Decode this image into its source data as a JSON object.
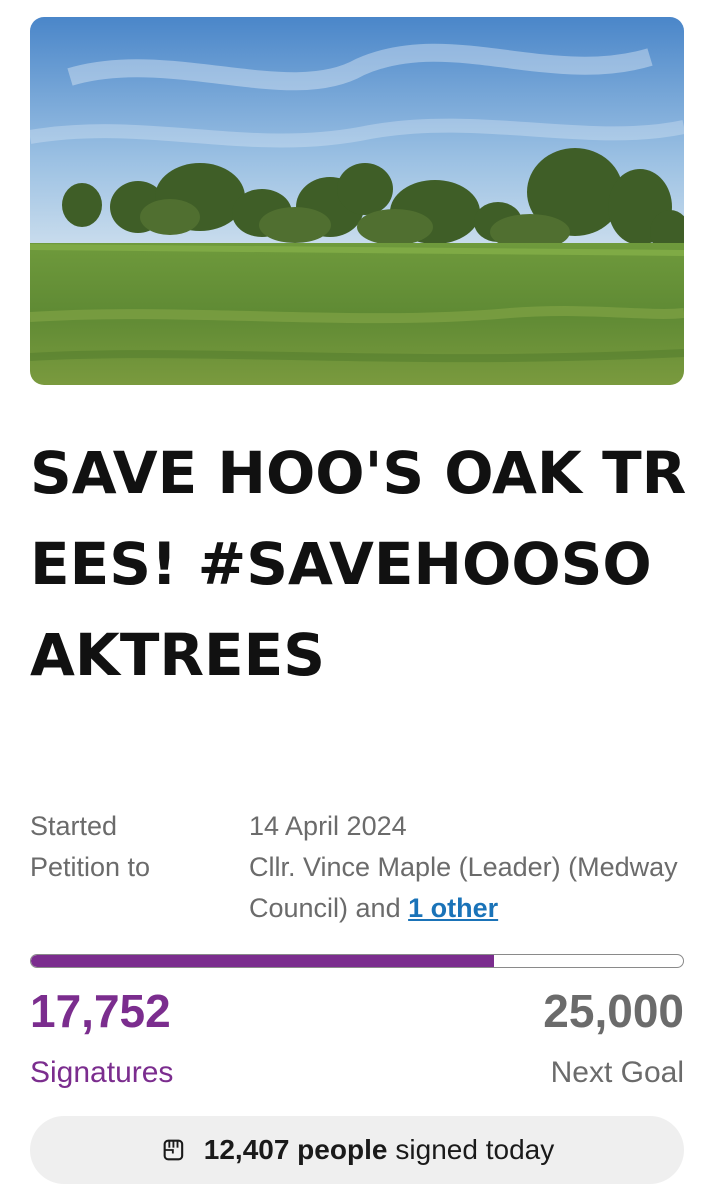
{
  "hero": {
    "image": "field-with-oak-trees-photo"
  },
  "petition": {
    "title": "SAVE HOO'S OAK TREES! #SAVEHOOSOAKTREES",
    "started_label": "Started",
    "started_date": "14 April 2024",
    "petition_to_label": "Petition to",
    "petition_to_value": "Cllr. Vince Maple (Leader) (Medway Council) and",
    "other_link": "1 other"
  },
  "progress": {
    "signatures": "17,752",
    "signatures_label": "Signatures",
    "goal": "25,000",
    "goal_label": "Next Goal",
    "fraction": 0.71
  },
  "today": {
    "icon": "raised-fist-icon",
    "count": "12,407 people",
    "suffix": "signed today"
  },
  "colors": {
    "accent": "#7b2d8e",
    "link": "#1a73b8",
    "muted": "#6b6b6b"
  }
}
